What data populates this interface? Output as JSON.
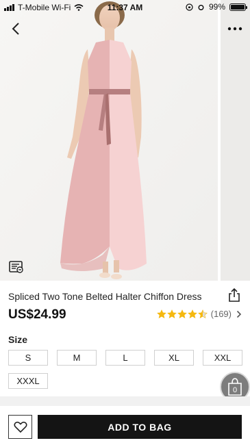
{
  "status_bar": {
    "carrier": "T-Mobile Wi-Fi",
    "time": "11:37 AM",
    "battery": "99%",
    "battery_level": 0.99
  },
  "product": {
    "title": "Spliced Two Tone Belted Halter Chiffon Dress",
    "price": "US$24.99",
    "rating_value": 4.5,
    "rating_count": "(169)"
  },
  "size": {
    "heading": "Size",
    "options": [
      "S",
      "M",
      "L",
      "XL",
      "XXL",
      "XXXL"
    ]
  },
  "bag": {
    "count": "0"
  },
  "actions": {
    "add_to_bag": "ADD TO BAG"
  },
  "colors": {
    "dress_left": "#e6b3b3",
    "dress_right": "#f6d2d2",
    "belt": "#b67f80",
    "star": "#f5b80f",
    "button_dark": "#141414"
  },
  "icons": [
    "back-chevron-icon",
    "more-dots-icon",
    "size-guide-icon",
    "share-icon",
    "star-icon",
    "chevron-right-icon",
    "shopping-bag-icon",
    "heart-icon",
    "wifi-icon",
    "alarm-icon",
    "orientation-lock-icon",
    "battery-icon"
  ]
}
